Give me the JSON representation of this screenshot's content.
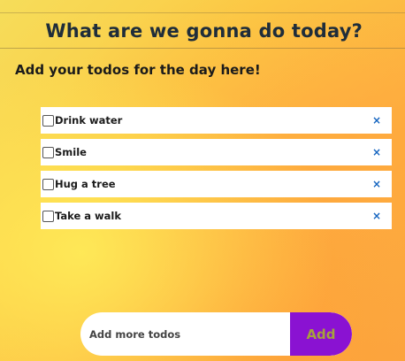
{
  "header": {
    "title": "What are we gonna do today?"
  },
  "subtitle": "Add your todos for the day here!",
  "todos": [
    {
      "label": "Drink water",
      "checked": false,
      "remove_icon": "close-icon"
    },
    {
      "label": "Smile",
      "checked": false,
      "remove_icon": "close-icon"
    },
    {
      "label": "Hug a tree",
      "checked": false,
      "remove_icon": "close-icon"
    },
    {
      "label": "Take a walk",
      "checked": false,
      "remove_icon": "close-icon"
    }
  ],
  "remove_glyph": "×",
  "add_form": {
    "placeholder": "Add more todos",
    "value": "",
    "button_label": "Add"
  },
  "colors": {
    "accent": "#8a12d2",
    "button_text": "#a6a23b",
    "remove": "#1565c0",
    "title": "#1f2d3a"
  }
}
